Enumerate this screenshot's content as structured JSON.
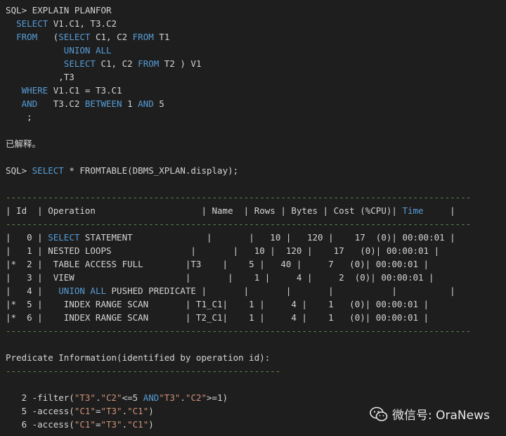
{
  "colors": {
    "background": "#1e1e1e",
    "text": "#d4d4d4",
    "keyword": "#569cd6",
    "string": "#ce9178",
    "number": "#b5cea8",
    "separator": "#608b4e"
  },
  "terminal": {
    "lines": [
      [
        {
          "t": "SQL> EXPLAIN PLANFOR",
          "c": ""
        }
      ],
      [
        {
          "t": "  ",
          "c": ""
        },
        {
          "t": "SELECT",
          "c": "kw"
        },
        {
          "t": " V1.C1, T3.C2",
          "c": ""
        }
      ],
      [
        {
          "t": "  ",
          "c": ""
        },
        {
          "t": "FROM",
          "c": "kw"
        },
        {
          "t": "   (",
          "c": ""
        },
        {
          "t": "SELECT",
          "c": "kw"
        },
        {
          "t": " C1, C2 ",
          "c": ""
        },
        {
          "t": "FROM",
          "c": "kw"
        },
        {
          "t": " T1",
          "c": ""
        }
      ],
      [
        {
          "t": "           ",
          "c": ""
        },
        {
          "t": "UNION ALL",
          "c": "kw"
        }
      ],
      [
        {
          "t": "           ",
          "c": ""
        },
        {
          "t": "SELECT",
          "c": "kw"
        },
        {
          "t": " C1, C2 ",
          "c": ""
        },
        {
          "t": "FROM",
          "c": "kw"
        },
        {
          "t": " T2 ) V1",
          "c": ""
        }
      ],
      [
        {
          "t": "          ,T3",
          "c": ""
        }
      ],
      [
        {
          "t": "   ",
          "c": ""
        },
        {
          "t": "WHERE",
          "c": "kw"
        },
        {
          "t": " V1.C1 = T3.C1",
          "c": ""
        }
      ],
      [
        {
          "t": "   ",
          "c": ""
        },
        {
          "t": "AND",
          "c": "kw"
        },
        {
          "t": "   T3.C2 ",
          "c": ""
        },
        {
          "t": "BETWEEN",
          "c": "kw"
        },
        {
          "t": " 1 ",
          "c": ""
        },
        {
          "t": "AND",
          "c": "kw"
        },
        {
          "t": " 5",
          "c": ""
        }
      ],
      [
        {
          "t": "    ;",
          "c": ""
        }
      ],
      [],
      [
        {
          "t": "已解释。",
          "c": "cjk"
        }
      ],
      [],
      [
        {
          "t": "SQL> ",
          "c": ""
        },
        {
          "t": "SELECT",
          "c": "kw"
        },
        {
          "t": " * FROMTABLE(DBMS_XPLAN.display);",
          "c": ""
        }
      ],
      [],
      [
        {
          "t": "----------------------------------------------------------------------------------------",
          "c": "dash"
        }
      ],
      [
        {
          "t": "| Id  | Operation                    | Name  | Rows | Bytes | Cost (%CPU)| ",
          "c": ""
        },
        {
          "t": "Time",
          "c": "kw"
        },
        {
          "t": "     |",
          "c": ""
        }
      ],
      [
        {
          "t": "----------------------------------------------------------------------------------------",
          "c": "dash"
        }
      ],
      [
        {
          "t": "|   0 | ",
          "c": ""
        },
        {
          "t": "SELECT",
          "c": "kw"
        },
        {
          "t": " STATEMENT              |       |   10 |   120 |    17  (0)| 00:00:01 |",
          "c": ""
        }
      ],
      [
        {
          "t": "|   1 | NESTED LOOPS               |       |   10 |  120 |    17   (0)| 00:00:01 |",
          "c": ""
        }
      ],
      [
        {
          "t": "|*  2 |  TABLE ACCESS FULL        |T3    |    5 |   40 |     7   (0)| 00:00:01 |",
          "c": ""
        }
      ],
      [
        {
          "t": "|   3 |  VIEW                     |       |    1 |     4 |     2  (0)| 00:00:01 |",
          "c": ""
        }
      ],
      [
        {
          "t": "|   4 |   ",
          "c": ""
        },
        {
          "t": "UNION ALL",
          "c": "kw"
        },
        {
          "t": " PUSHED PREDICATE |       |       |       |           |          |",
          "c": ""
        }
      ],
      [
        {
          "t": "|*  5 |    INDEX RANGE SCAN       | T1_C1|    1 |     4 |    1   (0)| 00:00:01 |",
          "c": ""
        }
      ],
      [
        {
          "t": "|*  6 |    INDEX RANGE SCAN       | T2_C1|    1 |     4 |    1   (0)| 00:00:01 |",
          "c": ""
        }
      ],
      [
        {
          "t": "----------------------------------------------------------------------------------------",
          "c": "dash"
        }
      ],
      [],
      [
        {
          "t": "Predicate Information(identified by operation id):",
          "c": ""
        }
      ],
      [
        {
          "t": "----------------------------------------------------",
          "c": "dash"
        }
      ],
      [],
      [
        {
          "t": "   2 -filter(",
          "c": ""
        },
        {
          "t": "\"T3\"",
          "c": "str"
        },
        {
          "t": ".",
          "c": ""
        },
        {
          "t": "\"C2\"",
          "c": "str"
        },
        {
          "t": "<=5 ",
          "c": ""
        },
        {
          "t": "AND",
          "c": "kw"
        },
        {
          "t": "\"T3\"",
          "c": "str"
        },
        {
          "t": ".",
          "c": ""
        },
        {
          "t": "\"C2\"",
          "c": "str"
        },
        {
          "t": ">=1)",
          "c": ""
        }
      ],
      [
        {
          "t": "   5 -access(",
          "c": ""
        },
        {
          "t": "\"C1\"",
          "c": "str"
        },
        {
          "t": "=",
          "c": ""
        },
        {
          "t": "\"T3\"",
          "c": "str"
        },
        {
          "t": ".",
          "c": ""
        },
        {
          "t": "\"C1\"",
          "c": "str"
        },
        {
          "t": ")",
          "c": ""
        }
      ],
      [
        {
          "t": "   6 -access(",
          "c": ""
        },
        {
          "t": "\"C1\"",
          "c": "str"
        },
        {
          "t": "=",
          "c": ""
        },
        {
          "t": "\"T3\"",
          "c": "str"
        },
        {
          "t": ".",
          "c": ""
        },
        {
          "t": "\"C1\"",
          "c": "str"
        },
        {
          "t": ")",
          "c": ""
        }
      ]
    ]
  },
  "watermark": {
    "text": "微信号: OraNews",
    "icon": "wechat-icon"
  }
}
